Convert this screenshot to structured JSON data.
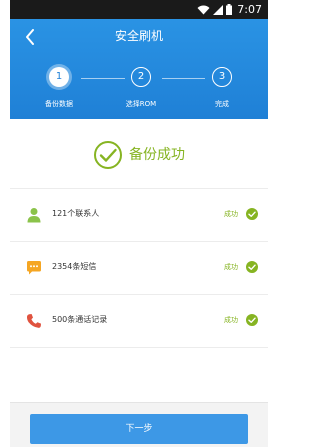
{
  "status_bar": {
    "time": "7:07"
  },
  "header": {
    "title": "安全刷机",
    "steps": [
      {
        "number": "1",
        "label": "备份数据",
        "state": "active"
      },
      {
        "number": "2",
        "label": "选择ROM",
        "state": "inactive"
      },
      {
        "number": "3",
        "label": "完成",
        "state": "inactive"
      }
    ]
  },
  "result": {
    "message": "备份成功"
  },
  "items": [
    {
      "icon": "contact-person-icon",
      "label": "121个联系人",
      "status": "成功"
    },
    {
      "icon": "sms-bubble-icon",
      "label": "2354条短信",
      "status": "成功"
    },
    {
      "icon": "phone-handset-icon",
      "label": "500条通话记录",
      "status": "成功"
    }
  ],
  "footer": {
    "next_label": "下一步"
  },
  "colors": {
    "header_blue": "#1f80d6",
    "accent_green": "#86b422",
    "button_blue": "#3d98e6",
    "contact_green": "#8bc34a",
    "sms_orange": "#f5a623",
    "phone_red": "#e0533f"
  }
}
